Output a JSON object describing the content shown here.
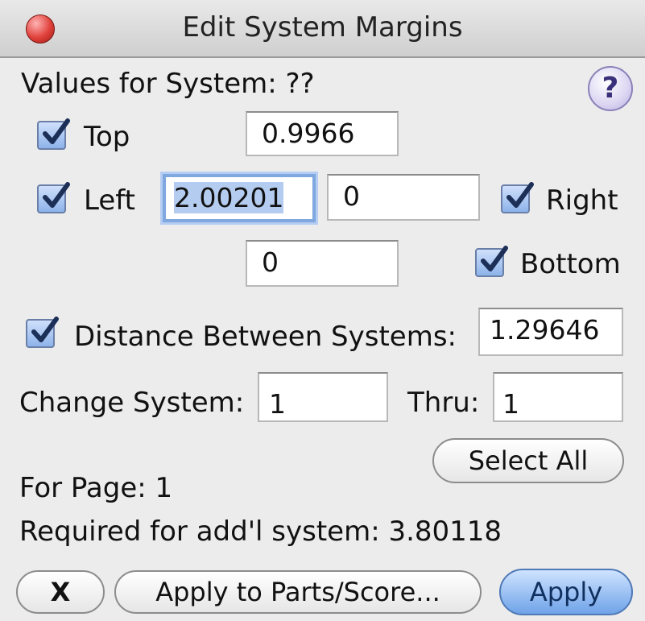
{
  "window": {
    "title": "Edit System Margins"
  },
  "header": {
    "values_label": "Values for System: ??",
    "help_symbol": "?"
  },
  "margins": {
    "top": {
      "label": "Top",
      "checked": true,
      "value": "0.9966"
    },
    "left": {
      "label": "Left",
      "checked": true,
      "value": "2.00201"
    },
    "right": {
      "label": "Right",
      "checked": true,
      "value": "0"
    },
    "bottom": {
      "label": "Bottom",
      "checked": true,
      "value": "0"
    }
  },
  "distance": {
    "label": "Distance Between Systems:",
    "checked": true,
    "value": "1.29646"
  },
  "range": {
    "change_label": "Change System:",
    "change_value": "1",
    "thru_label": "Thru:",
    "thru_value": "1"
  },
  "buttons": {
    "select_all": "Select All",
    "cancel": "X",
    "apply_parts": "Apply to Parts/Score...",
    "apply": "Apply"
  },
  "info": {
    "for_page": "For Page:  1",
    "required": "Required for add'l system: 3.80118"
  },
  "colors": {
    "accent": "#7fa7e0",
    "default_button": "#6fa3e8",
    "close": "#e0403a"
  }
}
